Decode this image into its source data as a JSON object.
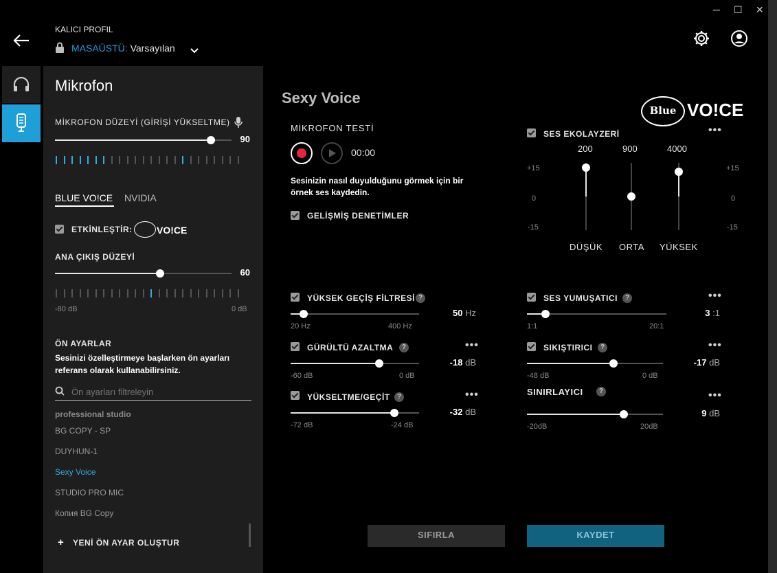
{
  "window": {
    "minimize": "─",
    "maximize": "☐",
    "close": "✕"
  },
  "header": {
    "profile_title": "KALICI PROFIL",
    "profile_category": "MASAÜSTÜ:",
    "profile_name": "Varsayılan"
  },
  "colors": {
    "accent": "#1e9fd8",
    "panel": "#1e1e1e",
    "record": "#e8253b",
    "save_button": "#10627f",
    "reset_button": "#2a2a2a"
  },
  "left": {
    "title": "Mikrofon",
    "mic_level_label": "MİKROFON DÜZEYİ (GİRİŞİ YÜKSELTME)",
    "mic_level_value": "90",
    "tabs": [
      "BLUE VO!CE",
      "NVIDIA"
    ],
    "enable_label": "ETKİNLEŞTİR:",
    "enable_logo_text": "VO!CE",
    "output_label": "ANA ÇIKIŞ DÜZEYİ",
    "output_value": "60",
    "output_min": "-80 dB",
    "output_max": "0 dB",
    "presets_title": "ÖN AYARLAR",
    "presets_desc_line1": "Sesinizi özelleştirmeye başlarken ön ayarları",
    "presets_desc_line2": "referans olarak kullanabilirsiniz.",
    "search_placeholder": "Ön ayarları filtreleyin",
    "presets": [
      "professional studio",
      "BG COPY - SP",
      "DUYHUN-1",
      "Sexy Voice",
      "STUDIO PRO MIC",
      "Копия BG Copy"
    ],
    "new_preset": "YENİ ÖN AYAR OLUŞTUR"
  },
  "main": {
    "title": "Sexy Voice",
    "brand": "VO!CE",
    "brand_badge": "Blue",
    "mic_test_title": "MİKROFON TESTİ",
    "timer": "00:00",
    "mic_test_desc_line1": "Sesinizin nasıl duyulduğunu görmek için bir",
    "mic_test_desc_line2": "örnek ses kaydedin.",
    "advanced_label": "GELİŞMİŞ DENETİMLER",
    "eq": {
      "label": "SES EKOLAYZERİ",
      "freqs": [
        "200",
        "900",
        "4000"
      ],
      "bands": [
        "DÜŞÜK",
        "ORTA",
        "YÜKSEK"
      ],
      "scale": [
        "+15",
        "0",
        "-15"
      ],
      "values": [
        13,
        0,
        11
      ]
    },
    "controls": {
      "highpass": {
        "label": "YÜKSEK GEÇİŞ FİLTRESİ",
        "value": "50",
        "unit": "Hz",
        "min": "20 Hz",
        "max": "400 Hz"
      },
      "noise": {
        "label": "GÜRÜLTÜ AZALTMA",
        "value": "-18",
        "unit": "dB",
        "min": "-60 dB",
        "max": "0 dB"
      },
      "gate": {
        "label": "YÜKSELTME/GEÇİT",
        "value": "-32",
        "unit": "dB",
        "min": "-72 dB",
        "max": "-24 dB"
      },
      "deesser": {
        "label": "SES YUMUŞATICI",
        "value": "3",
        "unit": ":1",
        "min": "1:1",
        "max": "20:1"
      },
      "compressor": {
        "label": "SIKIŞTIRICI",
        "value": "-17",
        "unit": "dB",
        "min": "-48 dB",
        "max": "0 dB"
      },
      "limiter": {
        "label": "SINIRLAYICI",
        "value": "9",
        "unit": "dB",
        "min": "-20dB",
        "max": "20dB"
      }
    },
    "reset_button": "SIFIRLA",
    "save_button": "KAYDET"
  }
}
